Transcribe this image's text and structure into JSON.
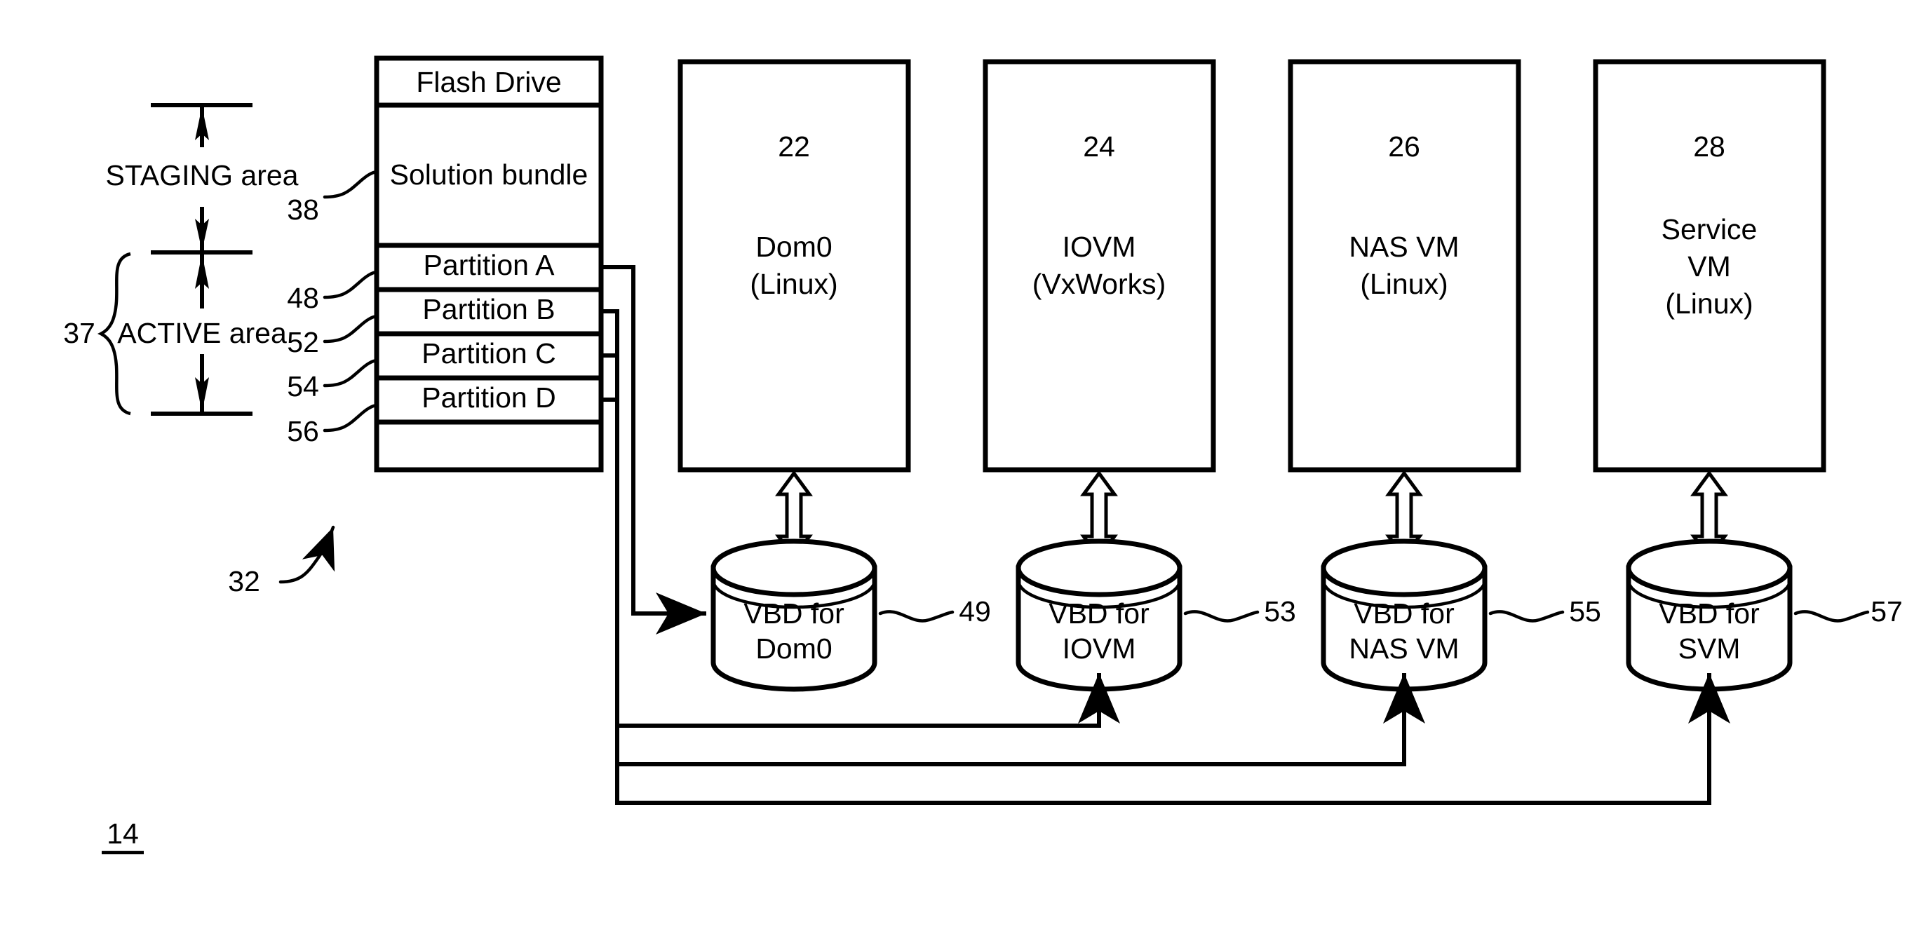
{
  "figure": {
    "figure_number": "14",
    "system_ref": "32"
  },
  "memory_map": {
    "staging_label": "STAGING area",
    "active_label": "ACTIVE area",
    "active_brace_ref": "37"
  },
  "flash_drive": {
    "title": "Flash Drive",
    "rows": [
      {
        "label": "Solution bundle",
        "ref": "38"
      },
      {
        "label": "Partition A",
        "ref": "48"
      },
      {
        "label": "Partition B",
        "ref": "52"
      },
      {
        "label": "Partition C",
        "ref": "54"
      },
      {
        "label": "Partition D",
        "ref": "56"
      }
    ]
  },
  "vms": [
    {
      "ref": "22",
      "name": "Dom0",
      "os": "(Linux)",
      "name2": ""
    },
    {
      "ref": "24",
      "name": "IOVM",
      "os": "(VxWorks)",
      "name2": ""
    },
    {
      "ref": "26",
      "name": "NAS VM",
      "os": "(Linux)",
      "name2": ""
    },
    {
      "ref": "28",
      "name": "Service",
      "name2": "VM",
      "os": "(Linux)"
    }
  ],
  "vbds": [
    {
      "line1": "VBD for",
      "line2": "Dom0",
      "ref": "49"
    },
    {
      "line1": "VBD for",
      "line2": "IOVM",
      "ref": "53"
    },
    {
      "line1": "VBD for",
      "line2": "NAS VM",
      "ref": "55"
    },
    {
      "line1": "VBD for",
      "line2": "SVM",
      "ref": "57"
    }
  ],
  "colors": {
    "ink": "#000000",
    "paper": "#ffffff"
  }
}
